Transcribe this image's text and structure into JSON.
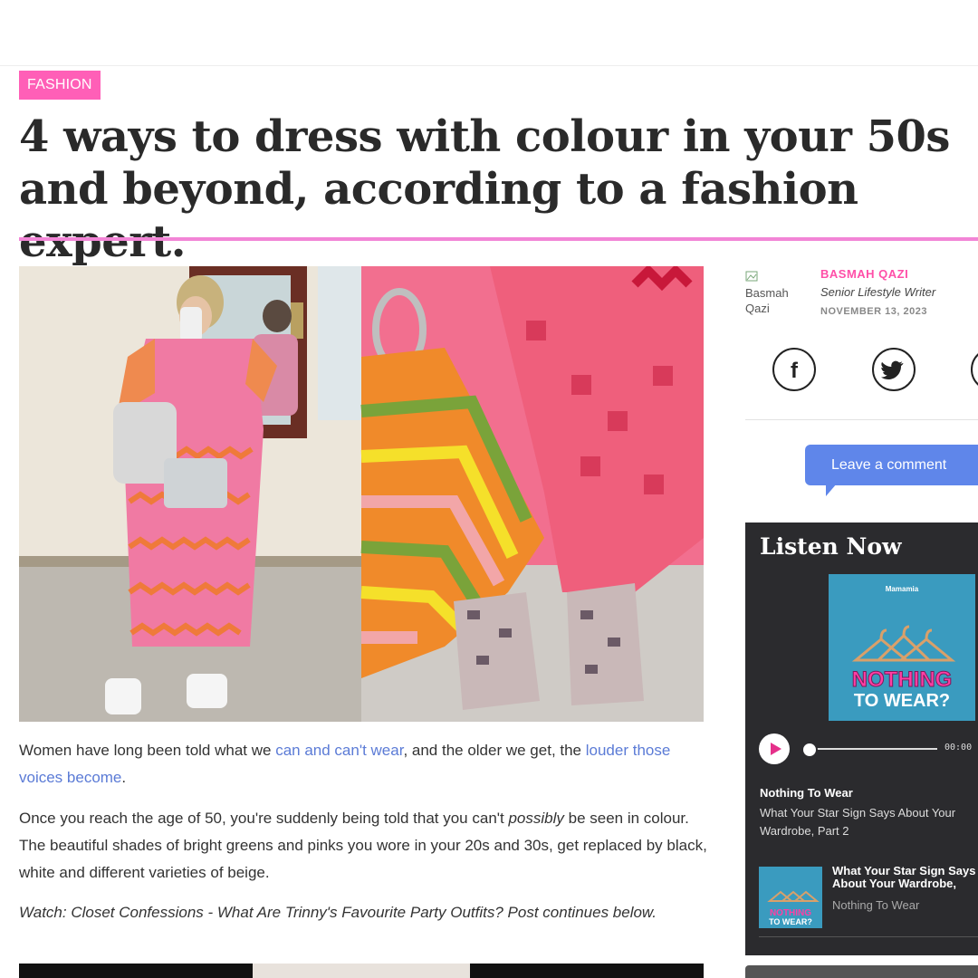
{
  "article": {
    "category": "FASHION",
    "headline": "4 ways to dress with colour in your 50s and beyond, according to a fashion expert.",
    "hero_alt": "Woman in pink kaftan taking mirror selfie and close-up of striped scarf and snakeskin sandals",
    "p1": {
      "part1": "Women have long been told what we ",
      "link1": "can and can't wear",
      "part2": ", and the older we get, the ",
      "link2": "louder those voices become",
      "part3": "."
    },
    "p2": {
      "part1": "Once you reach the age of 50, you're suddenly being told that you can't ",
      "em": "possibly",
      "part2": " be seen in colour. The beautiful shades of bright greens and pinks you wore in your 20s and 30s, get replaced by black, white and different varieties of beige."
    },
    "p3": "Watch: Closet Confessions - What Are Trinny's Favourite Party Outfits? Post continues below."
  },
  "author": {
    "image_alt": "Basmah Qazi",
    "name": "BASMAH QAZI",
    "role": "Senior Lifestyle Writer",
    "date": "NOVEMBER 13, 2023"
  },
  "social": [
    {
      "icon": "facebook-icon",
      "glyph": "f"
    },
    {
      "icon": "twitter-icon"
    },
    {
      "icon": "share-icon"
    }
  ],
  "comment_button": "Leave a comment",
  "listen": {
    "title": "Listen Now",
    "cover_brand": "Mamamia",
    "cover_line1": "NOTHING",
    "cover_line2": "TO WEAR?",
    "time": "00:00",
    "show": "Nothing To Wear",
    "episode": "What Your Star Sign Says About Your Wardrobe, Part 2",
    "next_episode": "What Your Star Sign Says About Your Wardrobe,",
    "next_show": "Nothing To Wear",
    "mini_line1": "NOTHING",
    "mini_line2": "TO WEAR?"
  },
  "colors": {
    "accent_pink": "#ff5fb7",
    "rule_pink": "#f285d6",
    "link_blue": "#5b7bd6",
    "button_blue": "#5f86ea",
    "dark_panel": "#2b2b2e",
    "cover_teal": "#3a9bbf"
  }
}
